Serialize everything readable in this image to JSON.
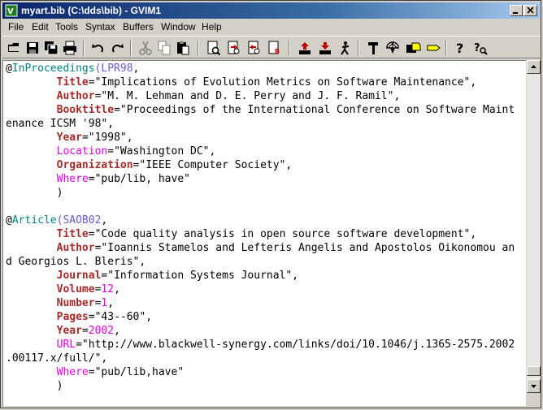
{
  "window": {
    "title": "myart.bib (C:\\dds\\bib) - GVIM1"
  },
  "menu": {
    "items": [
      "File",
      "Edit",
      "Tools",
      "Syntax",
      "Buffers",
      "Window",
      "Help"
    ]
  },
  "toolbar": {
    "icons": [
      "open-icon",
      "save-icon",
      "save-all-icon",
      "print-icon",
      "undo-icon",
      "redo-icon",
      "cut-icon",
      "copy-icon",
      "paste-icon",
      "find-icon",
      "find-next-icon",
      "find-prev-icon",
      "replace-icon",
      "load-session-icon",
      "save-session-icon",
      "run-script-icon",
      "make-icon",
      "shell-icon",
      "tags-icon",
      "tag-jump-icon",
      "help-icon",
      "find-help-icon"
    ]
  },
  "editor": {
    "entry1": {
      "head_at": "@",
      "head_type": "InProceedings",
      "head_open": "(",
      "head_key": "LPR98",
      "head_comma": ",",
      "title_field": "Title",
      "title_value": "=\"Implications of Evolution Metrics on Software Maintenance\",",
      "author_field": "Author",
      "author_value": "=\"M. M. Lehman and D. E. Perry and J. F. Ramil\",",
      "booktitle_field": "Booktitle",
      "booktitle_value": "=\"Proceedings of the International Conference on Software Maint",
      "booktitle_wrap": "enance ICSM '98\",",
      "year_field": "Year",
      "year_value": "=\"1998\",",
      "location_field": "Location",
      "location_value": "=\"Washington DC\",",
      "organization_field": "Organization",
      "organization_value": "=\"IEEE Computer Society\",",
      "where_field": "Where",
      "where_value": "=\"pub/lib, have\"",
      "close": ")"
    },
    "entry2": {
      "head_at": "@",
      "head_type": "Article",
      "head_open": "(",
      "head_key": "SAOB02",
      "head_comma": ",",
      "title_field": "Title",
      "title_value": "=\"Code quality analysis in open source software development\",",
      "author_field": "Author",
      "author_value": "=\"Ioannis Stamelos and Lefteris Angelis and Apostolos Oikonomou an",
      "author_wrap": "d Georgios L. Bleris\",",
      "journal_field": "Journal",
      "journal_value": "=\"Information Systems Journal\",",
      "volume_field": "Volume",
      "volume_eq": "=",
      "volume_num": "12",
      "volume_comma": ",",
      "number_field": "Number",
      "number_eq": "=",
      "number_num": "1",
      "number_comma": ",",
      "pages_field": "Pages",
      "pages_value": "=\"43--60\",",
      "year_field": "Year",
      "year_eq": "=",
      "year_num": "2002",
      "year_comma": ",",
      "url_field": "URL",
      "url_value": "=\"http://www.blackwell-synergy.com/links/doi/10.1046/j.1365-2575.2002",
      "url_wrap": ".00117.x/full/\",",
      "where_field": "Where",
      "where_value": "=\"pub/lib,have\"",
      "close": ")"
    }
  },
  "colors": {
    "field_bold": "#a52a2a",
    "field_magenta": "#e000e0",
    "entry_type": "#008080",
    "entry_key": "#6a5acd",
    "title_bar_start": "#0a246a"
  }
}
